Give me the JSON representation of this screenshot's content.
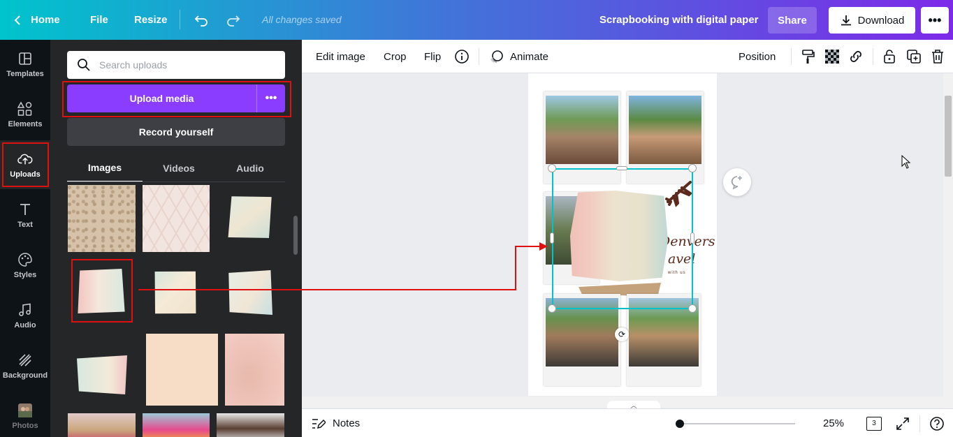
{
  "topbar": {
    "home": "Home",
    "file": "File",
    "resize": "Resize",
    "saved_status": "All changes saved",
    "title": "Scrapbooking with digital paper",
    "share": "Share",
    "download": "Download"
  },
  "rail": {
    "items": [
      {
        "label": "Templates",
        "icon": "templates-icon"
      },
      {
        "label": "Elements",
        "icon": "elements-icon"
      },
      {
        "label": "Uploads",
        "icon": "cloud-upload-icon"
      },
      {
        "label": "Text",
        "icon": "text-icon"
      },
      {
        "label": "Styles",
        "icon": "palette-icon"
      },
      {
        "label": "Audio",
        "icon": "music-note-icon"
      },
      {
        "label": "Background",
        "icon": "background-pattern-icon"
      },
      {
        "label": "Photos",
        "icon": "photos-icon"
      }
    ],
    "active": "Uploads"
  },
  "panel": {
    "search_placeholder": "Search uploads",
    "upload_media": "Upload media",
    "record_yourself": "Record yourself",
    "tabs": [
      "Images",
      "Videos",
      "Audio"
    ],
    "active_tab": "Images"
  },
  "context_toolbar": {
    "edit_image": "Edit image",
    "crop": "Crop",
    "flip": "Flip",
    "animate": "Animate",
    "position": "Position"
  },
  "canvas": {
    "text_line1": "Denvers",
    "text_line2": "avel",
    "text_line3": "with us"
  },
  "bottom": {
    "notes": "Notes",
    "zoom": "25%",
    "page_count": "3",
    "zoom_level": 0.25
  },
  "colors": {
    "accent_purple": "#8b3dff",
    "annotation_red": "#e01010",
    "selection_teal": "#00c4cc"
  }
}
